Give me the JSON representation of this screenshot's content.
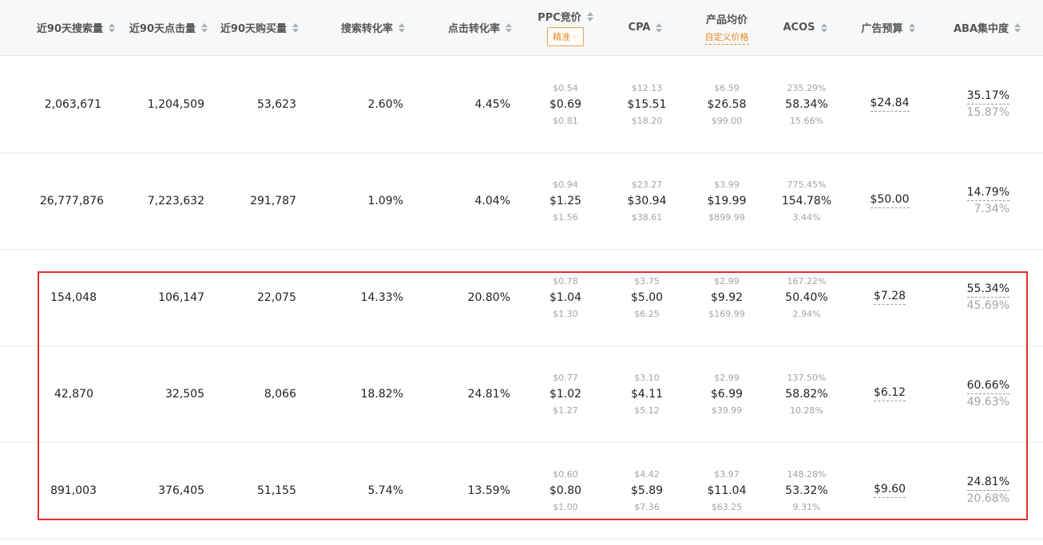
{
  "columns": {
    "search_volume": "近90天搜索量",
    "clicks": "近90天点击量",
    "purchases": "近90天购买量",
    "search_conv": "搜索转化率",
    "click_conv": "点击转化率",
    "ppc": "PPC竞价",
    "ppc_match": "精准",
    "cpa": "CPA",
    "avg_price": "产品均价",
    "avg_price_custom": "自定义价格",
    "acos": "ACOS",
    "budget": "广告预算",
    "aba": "ABA集中度"
  },
  "rows": [
    {
      "search_volume": "2,063,671",
      "clicks": "1,204,509",
      "purchases": "53,623",
      "search_conv": "2.60%",
      "click_conv": "4.45%",
      "ppc": {
        "low": "$0.54",
        "mid": "$0.69",
        "high": "$0.81"
      },
      "cpa": {
        "low": "$12.13",
        "mid": "$15.51",
        "high": "$18.20"
      },
      "price": {
        "low": "$6.59",
        "mid": "$26.58",
        "high": "$99.00"
      },
      "acos": {
        "low": "235.29%",
        "mid": "58.34%",
        "high": "15.66%"
      },
      "budget": "$24.84",
      "aba": {
        "top": "35.17%",
        "bottom": "15.87%"
      }
    },
    {
      "search_volume": "26,777,876",
      "clicks": "7,223,632",
      "purchases": "291,787",
      "search_conv": "1.09%",
      "click_conv": "4.04%",
      "ppc": {
        "low": "$0.94",
        "mid": "$1.25",
        "high": "$1.56"
      },
      "cpa": {
        "low": "$23.27",
        "mid": "$30.94",
        "high": "$38.61"
      },
      "price": {
        "low": "$3.99",
        "mid": "$19.99",
        "high": "$899.99"
      },
      "acos": {
        "low": "775.45%",
        "mid": "154.78%",
        "high": "3.44%"
      },
      "budget": "$50.00",
      "aba": {
        "top": "14.79%",
        "bottom": "7.34%"
      }
    },
    {
      "search_volume": "154,048",
      "clicks": "106,147",
      "purchases": "22,075",
      "search_conv": "14.33%",
      "click_conv": "20.80%",
      "ppc": {
        "low": "$0.78",
        "mid": "$1.04",
        "high": "$1.30"
      },
      "cpa": {
        "low": "$3.75",
        "mid": "$5.00",
        "high": "$6.25"
      },
      "price": {
        "low": "$2.99",
        "mid": "$9.92",
        "high": "$169.99"
      },
      "acos": {
        "low": "167.22%",
        "mid": "50.40%",
        "high": "2.94%"
      },
      "budget": "$7.28",
      "aba": {
        "top": "55.34%",
        "bottom": "45.69%"
      }
    },
    {
      "search_volume": "42,870",
      "clicks": "32,505",
      "purchases": "8,066",
      "search_conv": "18.82%",
      "click_conv": "24.81%",
      "ppc": {
        "low": "$0.77",
        "mid": "$1.02",
        "high": "$1.27"
      },
      "cpa": {
        "low": "$3.10",
        "mid": "$4.11",
        "high": "$5.12"
      },
      "price": {
        "low": "$2.99",
        "mid": "$6.99",
        "high": "$39.99"
      },
      "acos": {
        "low": "137.50%",
        "mid": "58.82%",
        "high": "10.28%"
      },
      "budget": "$6.12",
      "aba": {
        "top": "60.66%",
        "bottom": "49.63%"
      }
    },
    {
      "search_volume": "891,003",
      "clicks": "376,405",
      "purchases": "51,155",
      "search_conv": "5.74%",
      "click_conv": "13.59%",
      "ppc": {
        "low": "$0.60",
        "mid": "$0.80",
        "high": "$1.00"
      },
      "cpa": {
        "low": "$4.42",
        "mid": "$5.89",
        "high": "$7.36"
      },
      "price": {
        "low": "$3.97",
        "mid": "$11.04",
        "high": "$63.25"
      },
      "acos": {
        "low": "148.28%",
        "mid": "53.32%",
        "high": "9.31%"
      },
      "budget": "$9.60",
      "aba": {
        "top": "24.81%",
        "bottom": "20.68%"
      }
    }
  ],
  "highlight_color": "#e0302a",
  "accent_color": "#e8891e"
}
